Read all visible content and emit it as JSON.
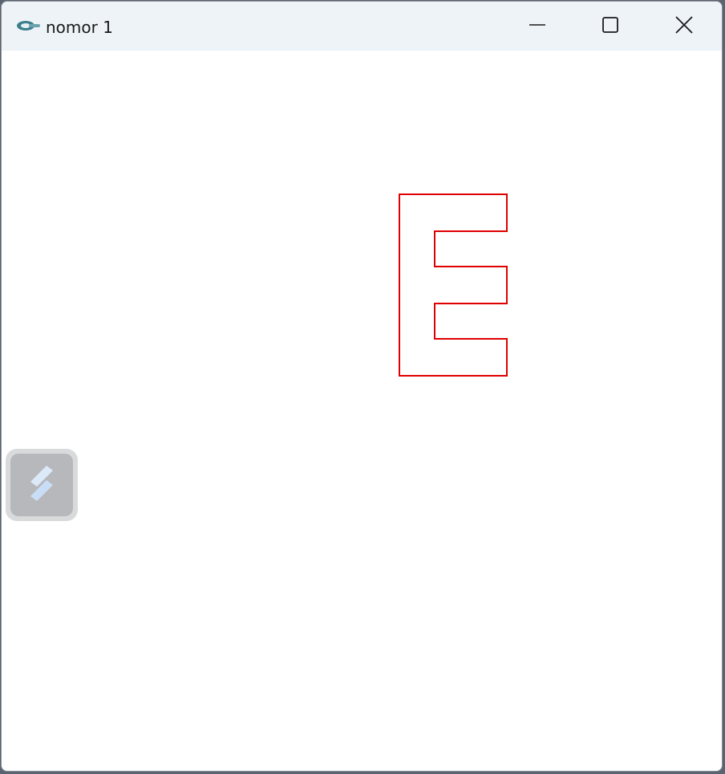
{
  "window": {
    "title": "nomor 1",
    "app_icon": "app-logo-icon",
    "controls": {
      "minimize_icon": "minimize-icon",
      "maximize_icon": "maximize-icon",
      "close_icon": "close-icon"
    }
  },
  "canvas": {
    "shape": "letter-e-outline",
    "stroke_color": "#e00000"
  },
  "floating_widget": {
    "icon": "s-logo-icon"
  },
  "colors": {
    "titlebar": "#eef3f8",
    "canvas_bg": "#ffffff",
    "shape_stroke": "#e00000"
  }
}
